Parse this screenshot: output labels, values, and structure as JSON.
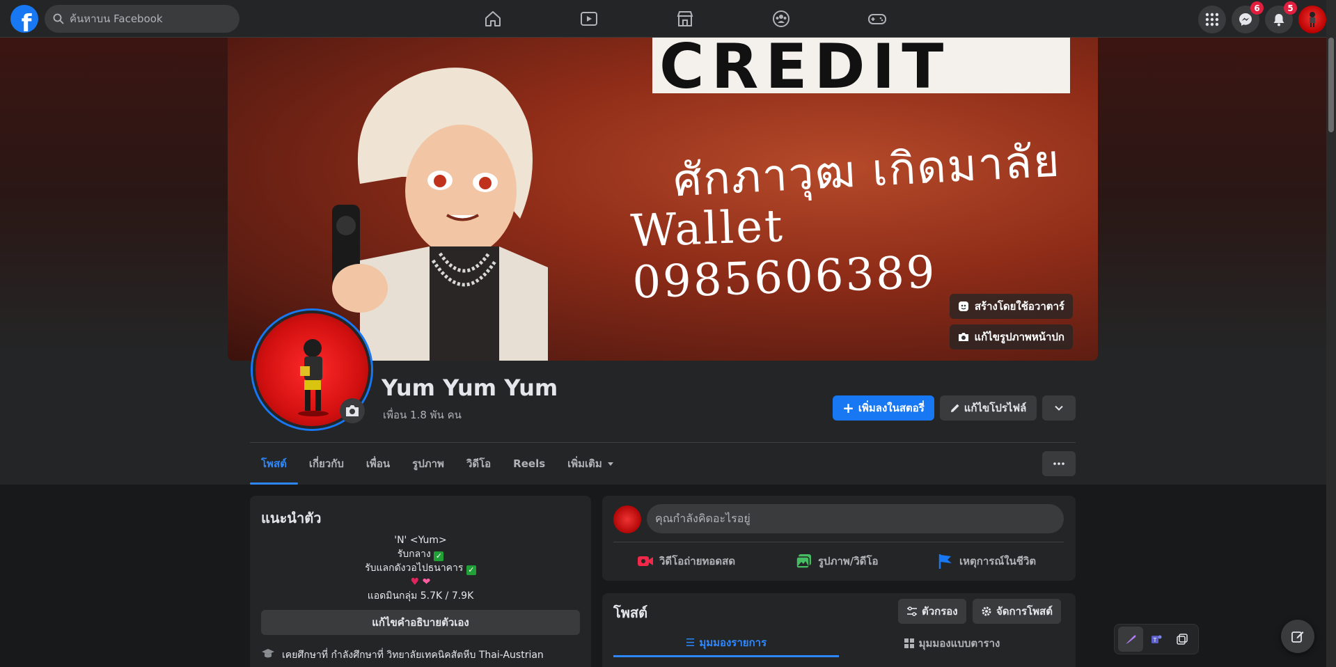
{
  "topbar": {
    "search_placeholder": "ค้นหาบน Facebook",
    "nav_icons": [
      "home-icon",
      "video-icon",
      "marketplace-icon",
      "groups-icon",
      "gaming-icon"
    ],
    "messenger_badge": "6",
    "notifications_badge": "5"
  },
  "cover": {
    "text_credit": "CREDIT",
    "text_name": "ศักภาวุฒ เกิดมาลัย",
    "text_wallet": "Wallet 0985606389",
    "avatar_button": "สร้างโดยใช้อวาตาร์",
    "edit_cover_button": "แก้ไขรูปภาพหน้าปก"
  },
  "profile": {
    "name": "Yum Yum Yum",
    "friends": "เพื่อน 1.8 พัน คน",
    "add_story": "เพิ่มลงในสตอรี่",
    "edit_profile": "แก้ไขโปรไฟล์"
  },
  "tabs": [
    {
      "label": "โพสต์",
      "active": true
    },
    {
      "label": "เกี่ยวกับ",
      "active": false
    },
    {
      "label": "เพื่อน",
      "active": false
    },
    {
      "label": "รูปภาพ",
      "active": false
    },
    {
      "label": "วิดีโอ",
      "active": false
    },
    {
      "label": "Reels",
      "active": false
    },
    {
      "label": "เพิ่มเติม",
      "active": false
    }
  ],
  "intro": {
    "title": "แนะนำตัว",
    "bio_lines": [
      "'N' <Yum>",
      "รับกลาง",
      "รับแลกดังวอไปธนาคาร",
      "",
      "แอดมินกลุ่ม 5.7K / 7.9K"
    ],
    "edit_bio": "แก้ไขคำอธิบายตัวเอง",
    "education": "เคยศึกษาที่ กำลังศึกษาที่ วิทยาลัยเทคนิคสัตหีบ Thai-Austrian"
  },
  "composer": {
    "placeholder": "คุณกำลังคิดอะไรอยู่",
    "live": "วิดีโอถ่ายทอดสด",
    "photo": "รูปภาพ/วิดีโอ",
    "life_event": "เหตุการณ์ในชีวิต"
  },
  "posts": {
    "title": "โพสต์",
    "filter": "ตัวกรอง",
    "manage": "จัดการโพสต์",
    "list_view": "มุมมองรายการ",
    "grid_view": "มุมมองแบบตาราง"
  },
  "colors": {
    "accent": "#2d88ff",
    "primary_button": "#1877f2",
    "badge": "#e41e3f",
    "background": "#18191a",
    "surface": "#242526"
  }
}
